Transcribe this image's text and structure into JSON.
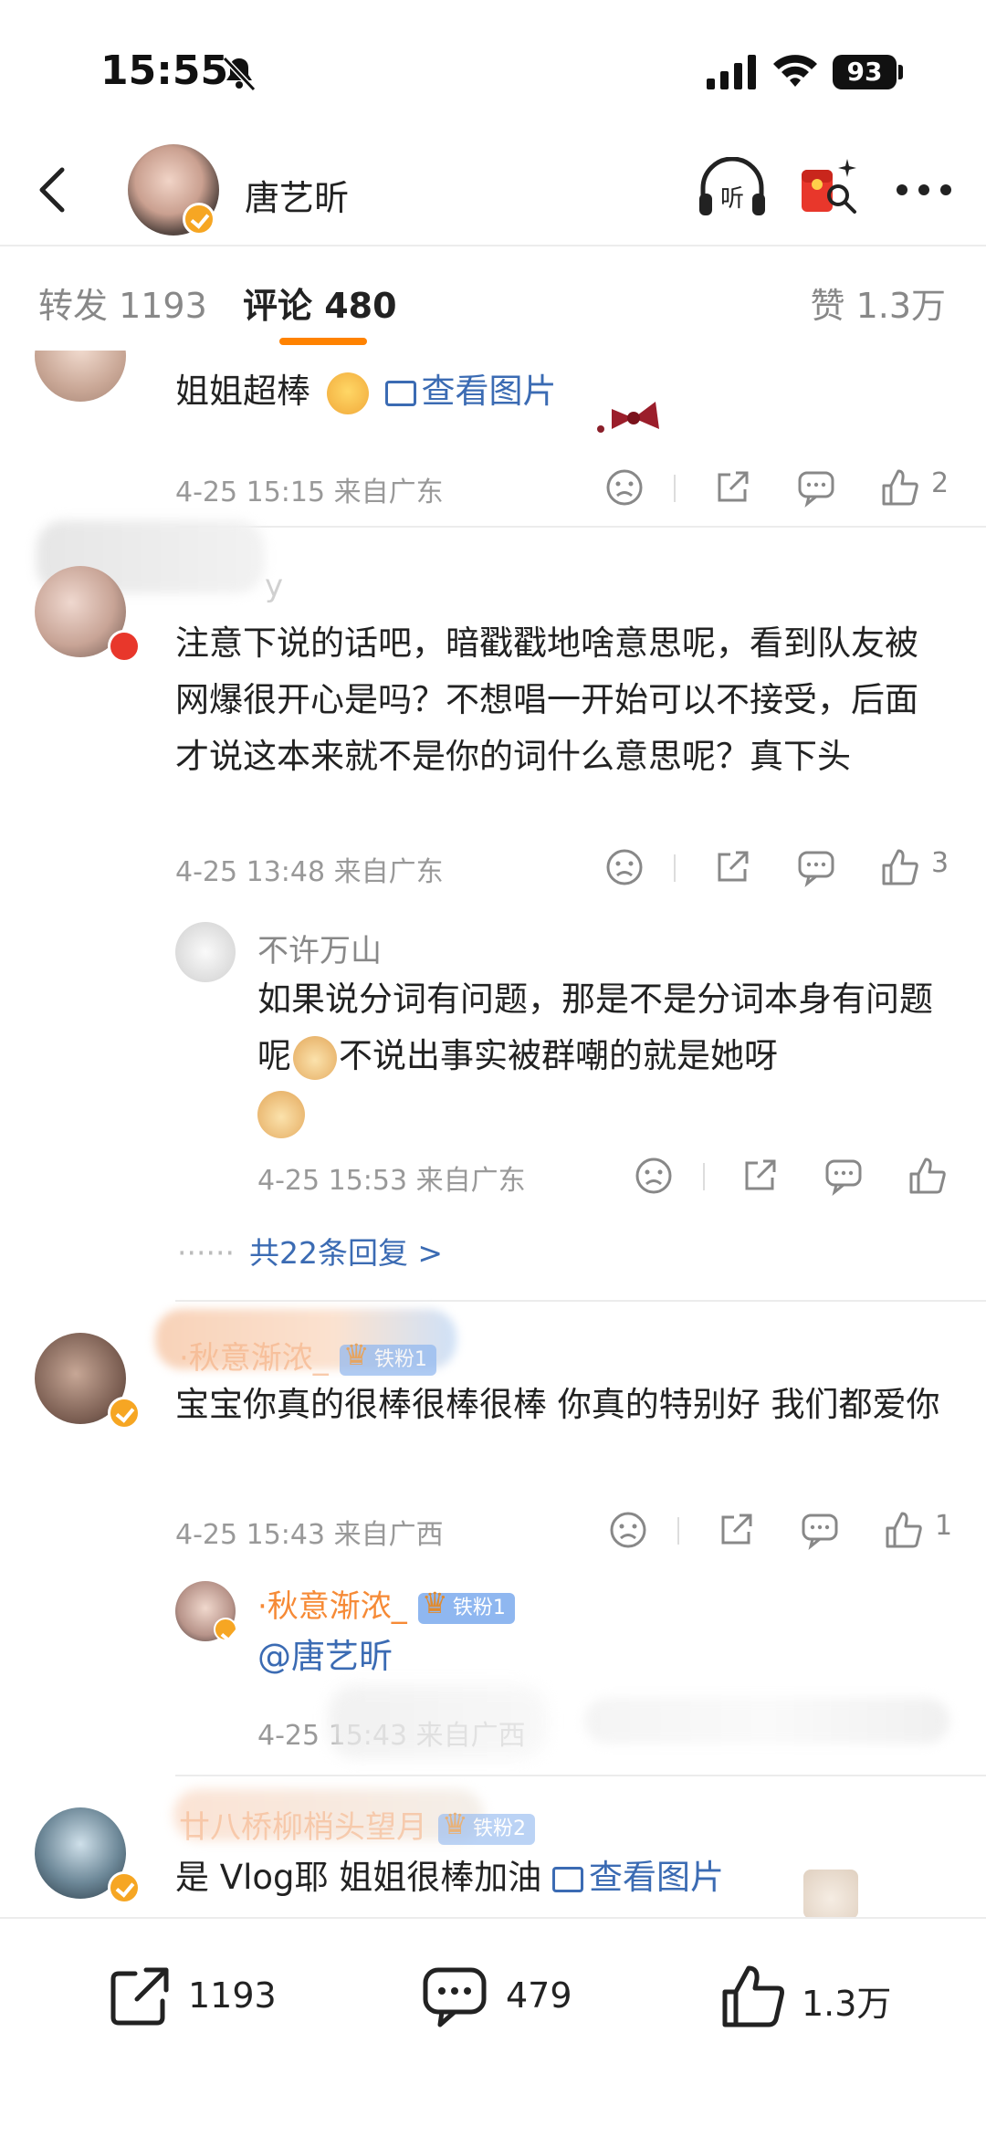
{
  "status_bar": {
    "time": "15:55",
    "battery": "93"
  },
  "header": {
    "title": "唐艺昕"
  },
  "tabs": {
    "repost": "转发 1193",
    "comments": "评论 480",
    "likes": "赞 1.3万"
  },
  "comments": [
    {
      "text": "姐姐超棒",
      "image_link": "查看图片",
      "meta": "4-25 15:15 来自广东",
      "like_count": "2"
    },
    {
      "username": "y",
      "text": "注意下说的话吧，暗戳戳地啥意思呢，看到队友被网爆很开心是吗？不想唱一开始可以不接受，后面才说这本来就不是你的词什么意思呢？真下头",
      "meta": "4-25 13:48 来自广东",
      "like_count": "3",
      "reply": {
        "username": "不许万山",
        "text": "如果说分词有问题，那是不是分词本身有问题呢",
        "text_after": "不说出事实被群嘲的就是她呀",
        "meta": "4-25 15:53 来自广东"
      },
      "replies_label": "共22条回复 >"
    },
    {
      "username": "·秋意渐浓_",
      "fan_badge": "铁粉1",
      "text": "宝宝你真的很棒很棒很棒 你真的特别好 我们都爱你",
      "meta": "4-25 15:43 来自广西",
      "like_count": "1",
      "reply": {
        "username": "·秋意渐浓_",
        "fan_badge": "铁粉1",
        "text": "@唐艺昕",
        "meta": "4-25 15:43 来自广西"
      }
    },
    {
      "username": "廿八桥柳梢头望月",
      "fan_badge": "铁粉2",
      "text": "是 Vlog耶 姐姐很棒加油",
      "image_link": "查看图片"
    }
  ],
  "bottom_bar": {
    "repost_count": "1193",
    "comment_count": "479",
    "like_count": "1.3万"
  }
}
